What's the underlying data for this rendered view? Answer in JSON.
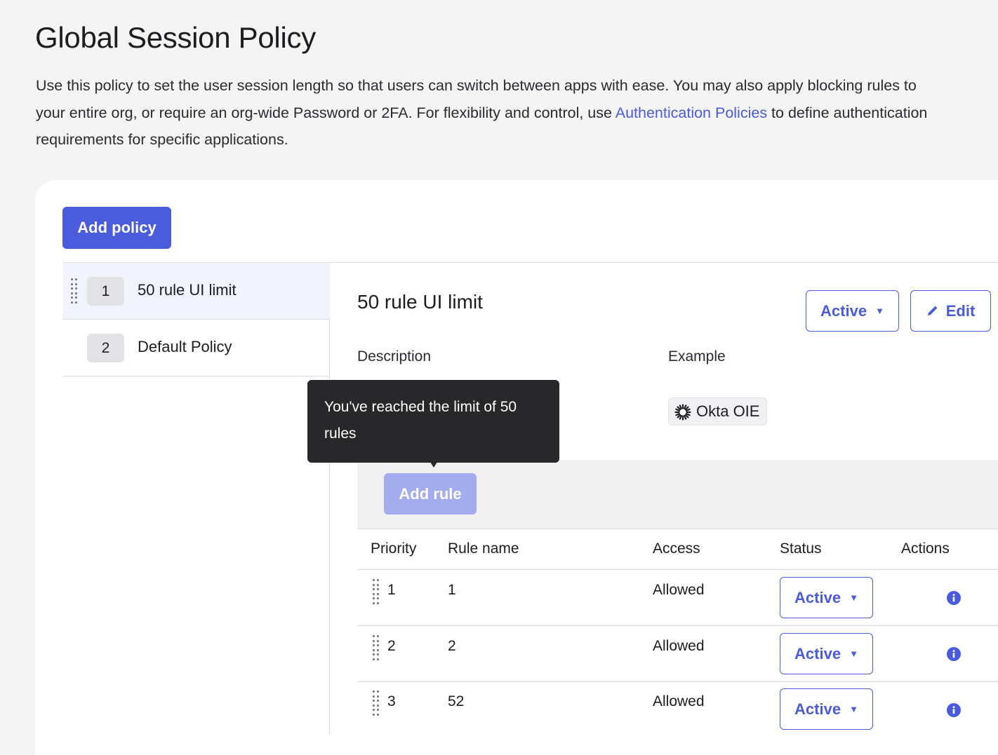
{
  "page": {
    "title": "Global Session Policy",
    "description_before": "Use this policy to set the user session length so that users can switch between apps with ease. You may also apply blocking rules to your entire org, or require an org-wide Password or 2FA. For flexibility and control, use ",
    "description_link": "Authentication Policies",
    "description_after": " to define authentication requirements for specific applications."
  },
  "toolbar": {
    "add_policy_label": "Add policy"
  },
  "policies": [
    {
      "priority": "1",
      "name": "50 rule UI limit",
      "selected": true
    },
    {
      "priority": "2",
      "name": "Default Policy",
      "selected": false
    }
  ],
  "detail": {
    "title": "50 rule UI limit",
    "status_label": "Active",
    "edit_label": "Edit",
    "description_label": "Description",
    "example_label": "Example",
    "example_chip": "Okta OIE",
    "add_rule_label": "Add rule",
    "tooltip_text": "You've reached the limit of 50 rules"
  },
  "rules_table": {
    "headers": {
      "priority": "Priority",
      "rule_name": "Rule name",
      "access": "Access",
      "status": "Status",
      "actions": "Actions"
    },
    "rows": [
      {
        "priority": "1",
        "name": "1",
        "access": "Allowed",
        "status": "Active"
      },
      {
        "priority": "2",
        "name": "2",
        "access": "Allowed",
        "status": "Active"
      },
      {
        "priority": "3",
        "name": "52",
        "access": "Allowed",
        "status": "Active"
      }
    ]
  },
  "colors": {
    "primary": "#4a5bdc",
    "primary_disabled": "#a3acec",
    "tooltip_bg": "#28282b",
    "selected_row_bg": "#f1f3fd"
  },
  "icons": {
    "drag_handle": "drag-handle-icon",
    "edit": "pencil-icon",
    "caret": "caret-down-icon",
    "info": "info-icon",
    "okta_logo": "okta-logo-icon"
  }
}
